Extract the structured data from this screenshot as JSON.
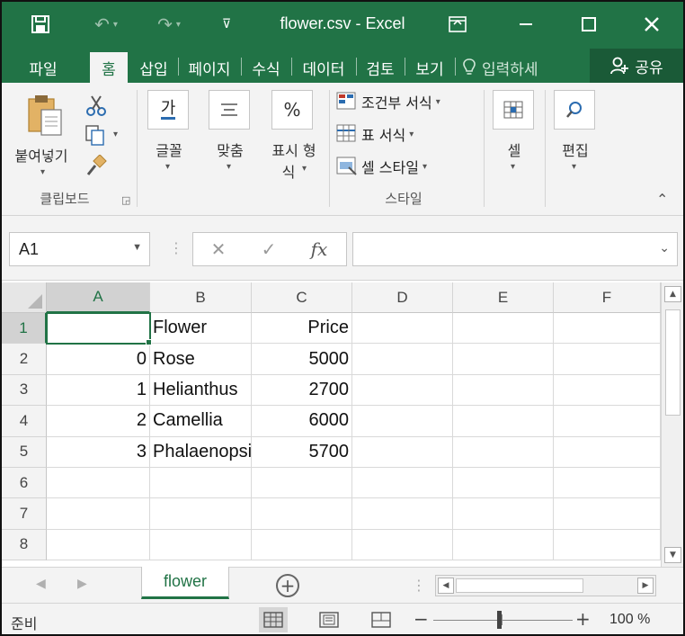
{
  "window": {
    "title": "flower.csv - Excel",
    "save_glyph": "🖫",
    "undo_glyph": "↶",
    "redo_glyph": "↷",
    "customize_glyph": "⊽",
    "ribbon_display_glyph": "⊡",
    "minimize_glyph": "—",
    "maximize_glyph": "☐",
    "close_glyph": "✕"
  },
  "tabs": [
    {
      "label": "파일"
    },
    {
      "label": "홈"
    },
    {
      "label": "삽입"
    },
    {
      "label": "페이지"
    },
    {
      "label": "수식"
    },
    {
      "label": "데이터"
    },
    {
      "label": "검토"
    },
    {
      "label": "보기"
    }
  ],
  "tell_me": {
    "placeholder": "입력하세"
  },
  "share": {
    "label": "공유"
  },
  "ribbon": {
    "clipboard": {
      "paste_label": "붙여넣기",
      "group_label": "클립보드"
    },
    "font": {
      "label": "글꼴",
      "glyph": "가"
    },
    "alignment": {
      "label": "맞춤"
    },
    "number": {
      "label_line1": "표시 형",
      "label_line2": "식",
      "glyph": "%"
    },
    "styles": {
      "conditional": "조건부 서식",
      "table": "표 서식",
      "cell_style": "셀 스타일",
      "group_label": "스타일"
    },
    "cells": {
      "label": "셀"
    },
    "editing": {
      "label": "편집"
    }
  },
  "formula_bar": {
    "name_box": "A1",
    "cancel_glyph": "✕",
    "enter_glyph": "✓",
    "fx_glyph": "fx",
    "value": ""
  },
  "sheet": {
    "columns": [
      "A",
      "B",
      "C",
      "D",
      "E",
      "F"
    ],
    "rows": [
      "1",
      "2",
      "3",
      "4",
      "5",
      "6",
      "7",
      "8"
    ],
    "cells": [
      [
        "",
        "Flower",
        "Price",
        "",
        "",
        ""
      ],
      [
        "0",
        "Rose",
        "5000",
        "",
        "",
        ""
      ],
      [
        "1",
        "Helianthus",
        "2700",
        "",
        "",
        ""
      ],
      [
        "2",
        "Camellia",
        "6000",
        "",
        "",
        ""
      ],
      [
        "3",
        "Phalaenopsis",
        "5700",
        "",
        "",
        ""
      ],
      [
        "",
        "",
        "",
        "",
        "",
        ""
      ],
      [
        "",
        "",
        "",
        "",
        "",
        ""
      ],
      [
        "",
        "",
        "",
        "",
        "",
        ""
      ]
    ],
    "active_cell": "A1"
  },
  "sheet_tabs": [
    {
      "label": "flower"
    }
  ],
  "status": {
    "ready": "준비",
    "zoom": "100 %",
    "zoom_level_percent": 100
  },
  "colors": {
    "excel_green": "#217346",
    "share_green": "#1a5a37",
    "ribbon_bg": "#f3f3f3"
  }
}
